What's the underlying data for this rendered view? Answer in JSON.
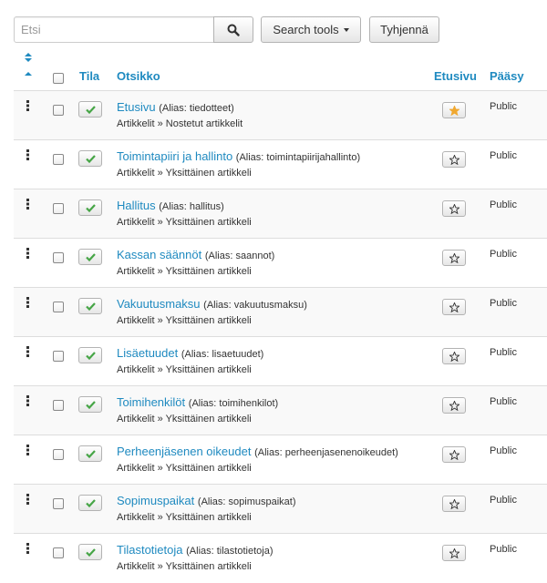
{
  "search": {
    "placeholder": "Etsi",
    "value": ""
  },
  "toolbar": {
    "search_tools_label": "Search tools",
    "clear_label": "Tyhjennä"
  },
  "columns": {
    "status": "Tila",
    "title": "Otsikko",
    "featured": "Etusivu",
    "access": "Pääsy"
  },
  "icons": {
    "search": "search-icon",
    "sort": "sort-icon",
    "drag": "drag-handle-icon",
    "published": "check-icon",
    "featured": "star-icon"
  },
  "colors": {
    "link": "#1f8ac0",
    "published_check": "#46a546",
    "featured_star": "#f0a830",
    "unfeatured_star": "#333333"
  },
  "rows": [
    {
      "title": "Etusivu",
      "alias": "(Alias: tiedotteet)",
      "category": "Artikkelit » Nostetut artikkelit",
      "featured": true,
      "access": "Public"
    },
    {
      "title": "Toimintapiiri ja hallinto",
      "alias": "(Alias: toimintapiirijahallinto)",
      "category": "Artikkelit » Yksittäinen artikkeli",
      "featured": false,
      "access": "Public"
    },
    {
      "title": "Hallitus",
      "alias": "(Alias: hallitus)",
      "category": "Artikkelit » Yksittäinen artikkeli",
      "featured": false,
      "access": "Public"
    },
    {
      "title": "Kassan säännöt",
      "alias": "(Alias: saannot)",
      "category": "Artikkelit » Yksittäinen artikkeli",
      "featured": false,
      "access": "Public"
    },
    {
      "title": "Vakuutusmaksu",
      "alias": "(Alias: vakuutusmaksu)",
      "category": "Artikkelit » Yksittäinen artikkeli",
      "featured": false,
      "access": "Public"
    },
    {
      "title": "Lisäetuudet",
      "alias": "(Alias: lisaetuudet)",
      "category": "Artikkelit » Yksittäinen artikkeli",
      "featured": false,
      "access": "Public"
    },
    {
      "title": "Toimihenkilöt",
      "alias": "(Alias: toimihenkilot)",
      "category": "Artikkelit » Yksittäinen artikkeli",
      "featured": false,
      "access": "Public"
    },
    {
      "title": "Perheenjäsenen oikeudet",
      "alias": "(Alias: perheenjasenenoikeudet)",
      "category": "Artikkelit » Yksittäinen artikkeli",
      "featured": false,
      "access": "Public"
    },
    {
      "title": "Sopimuspaikat",
      "alias": "(Alias: sopimuspaikat)",
      "category": "Artikkelit » Yksittäinen artikkeli",
      "featured": false,
      "access": "Public"
    },
    {
      "title": "Tilastotietoja",
      "alias": "(Alias: tilastotietoja)",
      "category": "Artikkelit » Yksittäinen artikkeli",
      "featured": false,
      "access": "Public"
    }
  ]
}
